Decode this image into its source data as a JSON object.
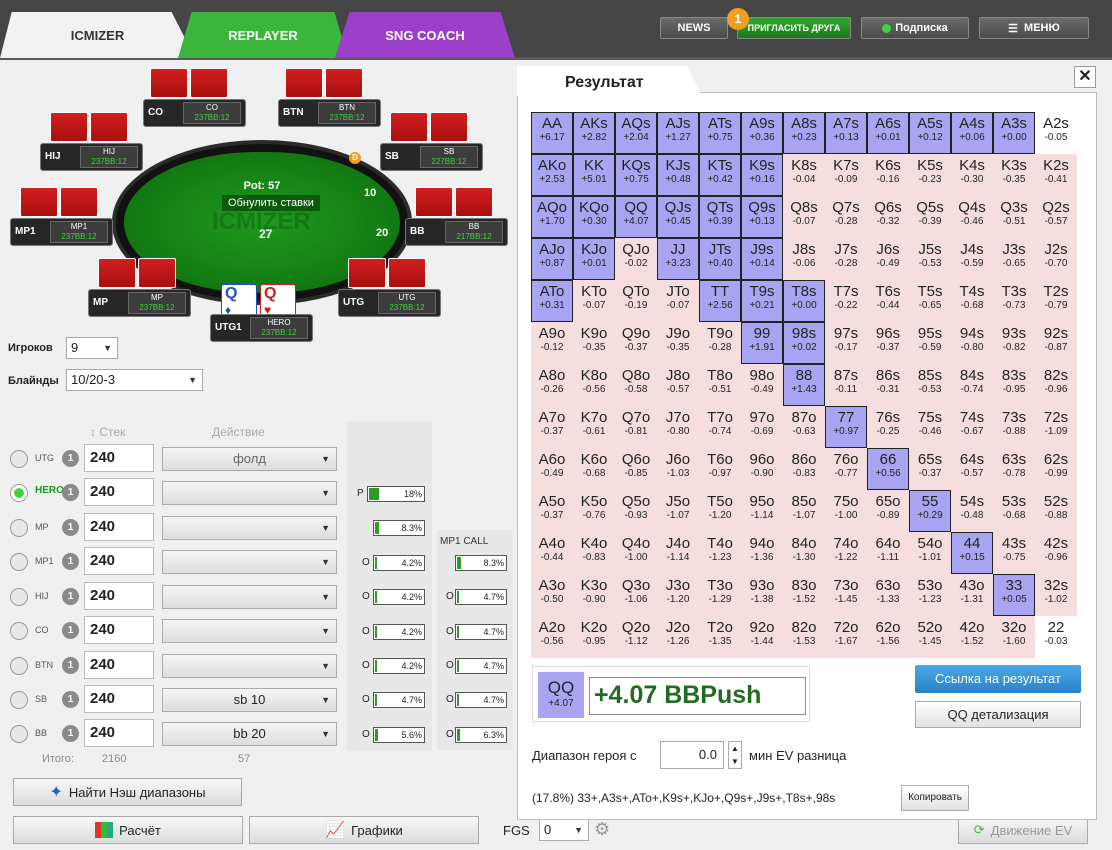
{
  "tabs": [
    "ICMIZER",
    "REPLAYER",
    "SNG COACH"
  ],
  "top": {
    "news": "NEWS",
    "invite": "ПРИГЛАСИТЬ ДРУГА",
    "badge": "1",
    "sub": "Подписка",
    "menu": "МЕНЮ"
  },
  "seats": [
    {
      "pos": "CO",
      "name": "CO",
      "stack": "237BB:12"
    },
    {
      "pos": "BTN",
      "name": "BTN",
      "stack": "237BB:12"
    },
    {
      "pos": "HIJ",
      "name": "HIJ",
      "stack": "237BB:12"
    },
    {
      "pos": "SB",
      "name": "SB",
      "stack": "227BB:12"
    },
    {
      "pos": "MP1",
      "name": "MP1",
      "stack": "237BB:12"
    },
    {
      "pos": "BB",
      "name": "BB",
      "stack": "217BB:12"
    },
    {
      "pos": "MP",
      "name": "MP",
      "stack": "237BB:12"
    },
    {
      "pos": "UTG",
      "name": "UTG",
      "stack": "237BB:12"
    },
    {
      "pos": "UTG1",
      "name": "HERO",
      "stack": "237BB:12"
    }
  ],
  "pot": {
    "label": "Pot: 57",
    "reset": "Обнулить ставки",
    "c1": "10",
    "c2": "20",
    "c3": "27",
    "d": "D"
  },
  "players_label": "Игроков",
  "players_val": "9",
  "blinds_label": "Блайнды",
  "blinds_val": "10/20-3",
  "stack_hdr": "Стек",
  "action_hdr": "Действие",
  "rows": [
    {
      "pos": "UTG",
      "n": "1",
      "stack": "240",
      "act": "фолд"
    },
    {
      "pos": "HERO",
      "n": "1",
      "stack": "240",
      "act": ""
    },
    {
      "pos": "MP",
      "n": "1",
      "stack": "240",
      "act": ""
    },
    {
      "pos": "MP1",
      "n": "1",
      "stack": "240",
      "act": ""
    },
    {
      "pos": "HIJ",
      "n": "1",
      "stack": "240",
      "act": ""
    },
    {
      "pos": "CO",
      "n": "1",
      "stack": "240",
      "act": ""
    },
    {
      "pos": "BTN",
      "n": "1",
      "stack": "240",
      "act": ""
    },
    {
      "pos": "SB",
      "n": "1",
      "stack": "240",
      "act": "sb 10"
    },
    {
      "pos": "BB",
      "n": "1",
      "stack": "240",
      "act": "bb 20"
    }
  ],
  "totals": {
    "label": "Итого:",
    "a": "2160",
    "b": "57"
  },
  "nash_btn": "Найти Нэш диапазоны",
  "calc_btn": "Расчёт",
  "graph_btn": "Графики",
  "fgs_label": "FGS",
  "fgs_val": "0",
  "ev_move": "Движение EV",
  "bars1": [
    {
      "l": "P",
      "v": "18%",
      "f": 0.18
    },
    {
      "l": "",
      "v": "8.3%",
      "f": 0.083
    },
    {
      "l": "O",
      "v": "4.2%",
      "f": 0.042
    },
    {
      "l": "O",
      "v": "4.2%",
      "f": 0.042
    },
    {
      "l": "O",
      "v": "4.2%",
      "f": 0.042
    },
    {
      "l": "O",
      "v": "4.2%",
      "f": 0.042
    },
    {
      "l": "O",
      "v": "4.7%",
      "f": 0.047
    },
    {
      "l": "O",
      "v": "5.6%",
      "f": 0.056
    }
  ],
  "col2_title": "MP1 CALL",
  "bars2": [
    {
      "l": "",
      "v": "8.3%",
      "f": 0.083
    },
    {
      "l": "O",
      "v": "4.7%",
      "f": 0.047
    },
    {
      "l": "O",
      "v": "4.7%",
      "f": 0.047
    },
    {
      "l": "O",
      "v": "4.7%",
      "f": 0.047
    },
    {
      "l": "O",
      "v": "4.7%",
      "f": 0.047
    },
    {
      "l": "O",
      "v": "6.3%",
      "f": 0.063
    }
  ],
  "result_title": "Результат",
  "grid": [
    [
      [
        "AA",
        "+6.17",
        1
      ],
      [
        "AKs",
        "+2.82",
        1
      ],
      [
        "AQs",
        "+2.04",
        1
      ],
      [
        "AJs",
        "+1.27",
        1
      ],
      [
        "ATs",
        "+0.75",
        1
      ],
      [
        "A9s",
        "+0.36",
        1
      ],
      [
        "A8s",
        "+0.23",
        1
      ],
      [
        "A7s",
        "+0.13",
        1
      ],
      [
        "A6s",
        "+0.01",
        1
      ],
      [
        "A5s",
        "+0.12",
        1
      ],
      [
        "A4s",
        "+0.06",
        1
      ],
      [
        "A3s",
        "+0.00",
        1
      ],
      [
        "A2s",
        "-0.05",
        2
      ]
    ],
    [
      [
        "AKo",
        "+2.53",
        1
      ],
      [
        "KK",
        "+5.01",
        1
      ],
      [
        "KQs",
        "+0.75",
        1
      ],
      [
        "KJs",
        "+0.48",
        1
      ],
      [
        "KTs",
        "+0.42",
        1
      ],
      [
        "K9s",
        "+0.16",
        1
      ],
      [
        "K8s",
        "-0.04",
        0
      ],
      [
        "K7s",
        "-0.09",
        0
      ],
      [
        "K6s",
        "-0.16",
        0
      ],
      [
        "K5s",
        "-0.23",
        0
      ],
      [
        "K4s",
        "-0.30",
        0
      ],
      [
        "K3s",
        "-0.35",
        0
      ],
      [
        "K2s",
        "-0.41",
        0
      ]
    ],
    [
      [
        "AQo",
        "+1.70",
        1
      ],
      [
        "KQo",
        "+0.30",
        1
      ],
      [
        "QQ",
        "+4.07",
        1
      ],
      [
        "QJs",
        "+0.45",
        1
      ],
      [
        "QTs",
        "+0.39",
        1
      ],
      [
        "Q9s",
        "+0.13",
        1
      ],
      [
        "Q8s",
        "-0.07",
        0
      ],
      [
        "Q7s",
        "-0.28",
        0
      ],
      [
        "Q6s",
        "-0.32",
        0
      ],
      [
        "Q5s",
        "-0.39",
        0
      ],
      [
        "Q4s",
        "-0.46",
        0
      ],
      [
        "Q3s",
        "-0.51",
        0
      ],
      [
        "Q2s",
        "-0.57",
        0
      ]
    ],
    [
      [
        "AJo",
        "+0.87",
        1
      ],
      [
        "KJo",
        "+0.01",
        1
      ],
      [
        "QJo",
        "-0.02",
        0
      ],
      [
        "JJ",
        "+3.23",
        1
      ],
      [
        "JTs",
        "+0.40",
        1
      ],
      [
        "J9s",
        "+0.14",
        1
      ],
      [
        "J8s",
        "-0.06",
        0
      ],
      [
        "J7s",
        "-0.28",
        0
      ],
      [
        "J6s",
        "-0.49",
        0
      ],
      [
        "J5s",
        "-0.53",
        0
      ],
      [
        "J4s",
        "-0.59",
        0
      ],
      [
        "J3s",
        "-0.65",
        0
      ],
      [
        "J2s",
        "-0.70",
        0
      ]
    ],
    [
      [
        "ATo",
        "+0.31",
        1
      ],
      [
        "KTo",
        "-0.07",
        0
      ],
      [
        "QTo",
        "-0.19",
        0
      ],
      [
        "JTo",
        "-0.07",
        0
      ],
      [
        "TT",
        "+2.56",
        1
      ],
      [
        "T9s",
        "+0.21",
        1
      ],
      [
        "T8s",
        "+0.00",
        1
      ],
      [
        "T7s",
        "-0.22",
        0
      ],
      [
        "T6s",
        "-0.44",
        0
      ],
      [
        "T5s",
        "-0.65",
        0
      ],
      [
        "T4s",
        "-0.68",
        0
      ],
      [
        "T3s",
        "-0.73",
        0
      ],
      [
        "T2s",
        "-0.79",
        0
      ]
    ],
    [
      [
        "A9o",
        "-0.12",
        0
      ],
      [
        "K9o",
        "-0.35",
        0
      ],
      [
        "Q9o",
        "-0.37",
        0
      ],
      [
        "J9o",
        "-0.35",
        0
      ],
      [
        "T9o",
        "-0.28",
        0
      ],
      [
        "99",
        "+1.91",
        1
      ],
      [
        "98s",
        "+0.02",
        1
      ],
      [
        "97s",
        "-0.17",
        0
      ],
      [
        "96s",
        "-0.37",
        0
      ],
      [
        "95s",
        "-0.59",
        0
      ],
      [
        "94s",
        "-0.80",
        0
      ],
      [
        "93s",
        "-0.82",
        0
      ],
      [
        "92s",
        "-0.87",
        0
      ]
    ],
    [
      [
        "A8o",
        "-0.26",
        0
      ],
      [
        "K8o",
        "-0.56",
        0
      ],
      [
        "Q8o",
        "-0.58",
        0
      ],
      [
        "J8o",
        "-0.57",
        0
      ],
      [
        "T8o",
        "-0.51",
        0
      ],
      [
        "98o",
        "-0.49",
        0
      ],
      [
        "88",
        "+1.43",
        1
      ],
      [
        "87s",
        "-0.11",
        0
      ],
      [
        "86s",
        "-0.31",
        0
      ],
      [
        "85s",
        "-0.53",
        0
      ],
      [
        "84s",
        "-0.74",
        0
      ],
      [
        "83s",
        "-0.95",
        0
      ],
      [
        "82s",
        "-0.96",
        0
      ]
    ],
    [
      [
        "A7o",
        "-0.37",
        0
      ],
      [
        "K7o",
        "-0.61",
        0
      ],
      [
        "Q7o",
        "-0.81",
        0
      ],
      [
        "J7o",
        "-0.80",
        0
      ],
      [
        "T7o",
        "-0.74",
        0
      ],
      [
        "97o",
        "-0.69",
        0
      ],
      [
        "87o",
        "-0.63",
        0
      ],
      [
        "77",
        "+0.97",
        1
      ],
      [
        "76s",
        "-0.25",
        0
      ],
      [
        "75s",
        "-0.46",
        0
      ],
      [
        "74s",
        "-0.67",
        0
      ],
      [
        "73s",
        "-0.88",
        0
      ],
      [
        "72s",
        "-1.09",
        0
      ]
    ],
    [
      [
        "A6o",
        "-0.49",
        0
      ],
      [
        "K6o",
        "-0.68",
        0
      ],
      [
        "Q6o",
        "-0.85",
        0
      ],
      [
        "J6o",
        "-1.03",
        0
      ],
      [
        "T6o",
        "-0.97",
        0
      ],
      [
        "96o",
        "-0.90",
        0
      ],
      [
        "86o",
        "-0.83",
        0
      ],
      [
        "76o",
        "-0.77",
        0
      ],
      [
        "66",
        "+0.56",
        1
      ],
      [
        "65s",
        "-0.37",
        0
      ],
      [
        "64s",
        "-0.57",
        0
      ],
      [
        "63s",
        "-0.78",
        0
      ],
      [
        "62s",
        "-0.99",
        0
      ]
    ],
    [
      [
        "A5o",
        "-0.37",
        0
      ],
      [
        "K5o",
        "-0.76",
        0
      ],
      [
        "Q5o",
        "-0.93",
        0
      ],
      [
        "J5o",
        "-1.07",
        0
      ],
      [
        "T5o",
        "-1.20",
        0
      ],
      [
        "95o",
        "-1.14",
        0
      ],
      [
        "85o",
        "-1.07",
        0
      ],
      [
        "75o",
        "-1.00",
        0
      ],
      [
        "65o",
        "-0.89",
        0
      ],
      [
        "55",
        "+0.29",
        1
      ],
      [
        "54s",
        "-0.48",
        0
      ],
      [
        "53s",
        "-0.68",
        0
      ],
      [
        "52s",
        "-0.88",
        0
      ]
    ],
    [
      [
        "A4o",
        "-0.44",
        0
      ],
      [
        "K4o",
        "-0.83",
        0
      ],
      [
        "Q4o",
        "-1.00",
        0
      ],
      [
        "J4o",
        "-1.14",
        0
      ],
      [
        "T4o",
        "-1.23",
        0
      ],
      [
        "94o",
        "-1.36",
        0
      ],
      [
        "84o",
        "-1.30",
        0
      ],
      [
        "74o",
        "-1.22",
        0
      ],
      [
        "64o",
        "-1.11",
        0
      ],
      [
        "54o",
        "-1.01",
        0
      ],
      [
        "44",
        "+0.15",
        1
      ],
      [
        "43s",
        "-0.75",
        0
      ],
      [
        "42s",
        "-0.96",
        0
      ]
    ],
    [
      [
        "A3o",
        "-0.50",
        0
      ],
      [
        "K3o",
        "-0.90",
        0
      ],
      [
        "Q3o",
        "-1.06",
        0
      ],
      [
        "J3o",
        "-1.20",
        0
      ],
      [
        "T3o",
        "-1.29",
        0
      ],
      [
        "93o",
        "-1.38",
        0
      ],
      [
        "83o",
        "-1.52",
        0
      ],
      [
        "73o",
        "-1.45",
        0
      ],
      [
        "63o",
        "-1.33",
        0
      ],
      [
        "53o",
        "-1.23",
        0
      ],
      [
        "43o",
        "-1.31",
        0
      ],
      [
        "33",
        "+0.05",
        1
      ],
      [
        "32s",
        "-1.02",
        0
      ]
    ],
    [
      [
        "A2o",
        "-0.56",
        0
      ],
      [
        "K2o",
        "-0.95",
        0
      ],
      [
        "Q2o",
        "-1.12",
        0
      ],
      [
        "J2o",
        "-1.26",
        0
      ],
      [
        "T2o",
        "-1.35",
        0
      ],
      [
        "92o",
        "-1.44",
        0
      ],
      [
        "82o",
        "-1.53",
        0
      ],
      [
        "72o",
        "-1.67",
        0
      ],
      [
        "62o",
        "-1.56",
        0
      ],
      [
        "52o",
        "-1.45",
        0
      ],
      [
        "42o",
        "-1.52",
        0
      ],
      [
        "32o",
        "-1.60",
        0
      ],
      [
        "22",
        "-0.03",
        2
      ]
    ]
  ],
  "sel_hand": "QQ",
  "sel_ev": "+4.07",
  "sel_big": "+4.07 BBPush",
  "link_btn": "Ссылка на результат",
  "detail_btn": "QQ детализация",
  "range_label": "Диапазон героя с",
  "range_val": "0.0",
  "range_suffix": "мин EV разница",
  "range_text": "(17.8%) 33+,A3s+,ATo+,K9s+,KJo+,Q9s+,J9s+,T8s+,98s",
  "copy_btn": "Копировать"
}
